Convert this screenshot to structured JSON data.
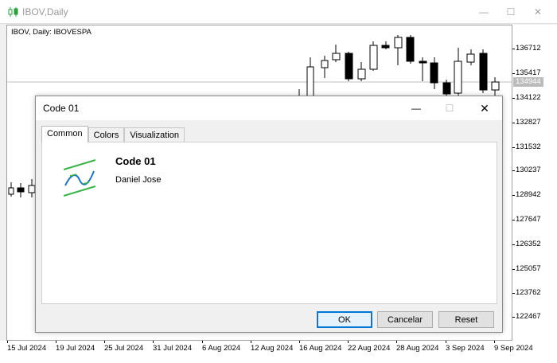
{
  "window": {
    "title": "IBOV,Daily",
    "minimize_glyph": "—",
    "maximize_glyph": "☐",
    "close_glyph": "✕"
  },
  "chart": {
    "label": "IBOV, Daily:  IBOVESPA",
    "price_ticks": [
      "136712",
      "135417",
      "134122",
      "132827",
      "131532",
      "130237",
      "128942",
      "127647",
      "126352",
      "125057",
      "123762",
      "122467"
    ],
    "current_price": "134944",
    "date_ticks": [
      "15 Jul 2024",
      "19 Jul 2024",
      "25 Jul 2024",
      "31 Jul 2024",
      "6 Aug 2024",
      "12 Aug 2024",
      "16 Aug 2024",
      "22 Aug 2024",
      "28 Aug 2024",
      "3 Sep 2024",
      "9 Sep 2024"
    ],
    "colors": {
      "bull_fill": "#ffffff",
      "bear_fill": "#000000",
      "outline": "#000000"
    }
  },
  "dialog": {
    "title": "Code 01",
    "minimize_glyph": "—",
    "maximize_glyph": "☐",
    "close_glyph": "✕",
    "tabs": [
      {
        "label": "Common",
        "active": true
      },
      {
        "label": "Colors",
        "active": false
      },
      {
        "label": "Visualization",
        "active": false
      }
    ],
    "indicator_name": "Code 01",
    "author": "Daniel Jose",
    "icon": "indicator-wave-icon",
    "buttons": {
      "ok": "OK",
      "cancel": "Cancelar",
      "reset": "Reset"
    },
    "accent": "#0078d7"
  }
}
